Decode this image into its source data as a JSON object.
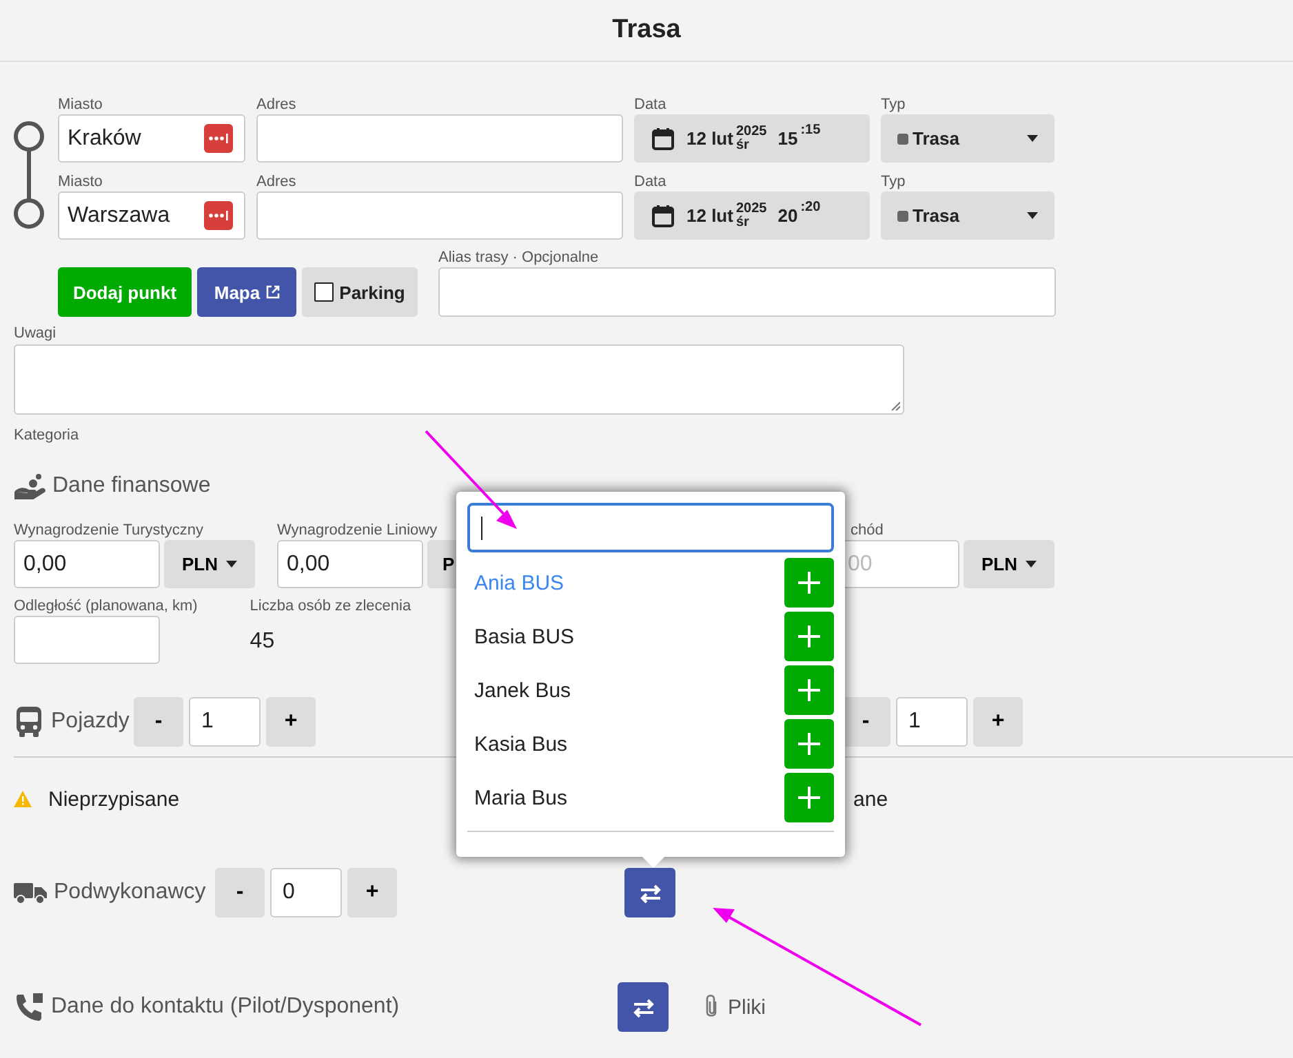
{
  "title": "Trasa",
  "route_points": [
    {
      "city_label": "Miasto",
      "city": "Kraków",
      "address_label": "Adres",
      "date_label": "Data",
      "day": "12 lut",
      "year": "2025",
      "weekday": "śr",
      "hour": "15",
      "minute": ":15",
      "type_label": "Typ",
      "type": "Trasa"
    },
    {
      "city_label": "Miasto",
      "city": "Warszawa",
      "address_label": "Adres",
      "date_label": "Data",
      "day": "12 lut",
      "year": "2025",
      "weekday": "śr",
      "hour": "20",
      "minute": ":20",
      "type_label": "Typ",
      "type": "Trasa"
    }
  ],
  "actions": {
    "add_point": "Dodaj punkt",
    "map": "Mapa",
    "parking": {
      "label": "Parking",
      "checked": false
    }
  },
  "alias": {
    "label": "Alias trasy · Opcjonalne"
  },
  "notes": {
    "label": "Uwagi"
  },
  "category": {
    "label": "Kategoria"
  },
  "finance": {
    "heading": "Dane finansowe",
    "fields": [
      {
        "label": "Wynagrodzenie Turystyczny",
        "value": "0,00",
        "currency": "PLN"
      },
      {
        "label": "Wynagrodzenie Liniowy",
        "value": "0,00",
        "currency": "P"
      },
      {
        "label": "chód",
        "placeholder": "00",
        "currency": "PLN"
      }
    ],
    "distance": {
      "label": "Odległość (planowana, km)"
    },
    "people": {
      "label": "Liczba osób ze zlecenia",
      "value": "45"
    }
  },
  "vehicles": {
    "label": "Pojazdy",
    "minus": "-",
    "value": "1",
    "plus": "+",
    "right_stepper": {
      "minus": "-",
      "value": "1",
      "plus": "+"
    }
  },
  "unassigned": {
    "label": "Nieprzypisane",
    "right_fragment": "ane"
  },
  "subcontractors": {
    "label": "Podwykonawcy",
    "minus": "-",
    "value": "0",
    "plus": "+"
  },
  "contact": {
    "label": "Dane do kontaktu (Pilot/Dysponent)",
    "files": "Pliki"
  },
  "popup": {
    "items": [
      {
        "name": "Ania BUS",
        "selected": true
      },
      {
        "name": "Basia BUS",
        "selected": false
      },
      {
        "name": "Janek Bus",
        "selected": false
      },
      {
        "name": "Kasia Bus",
        "selected": false
      },
      {
        "name": "Maria Bus",
        "selected": false
      }
    ]
  }
}
